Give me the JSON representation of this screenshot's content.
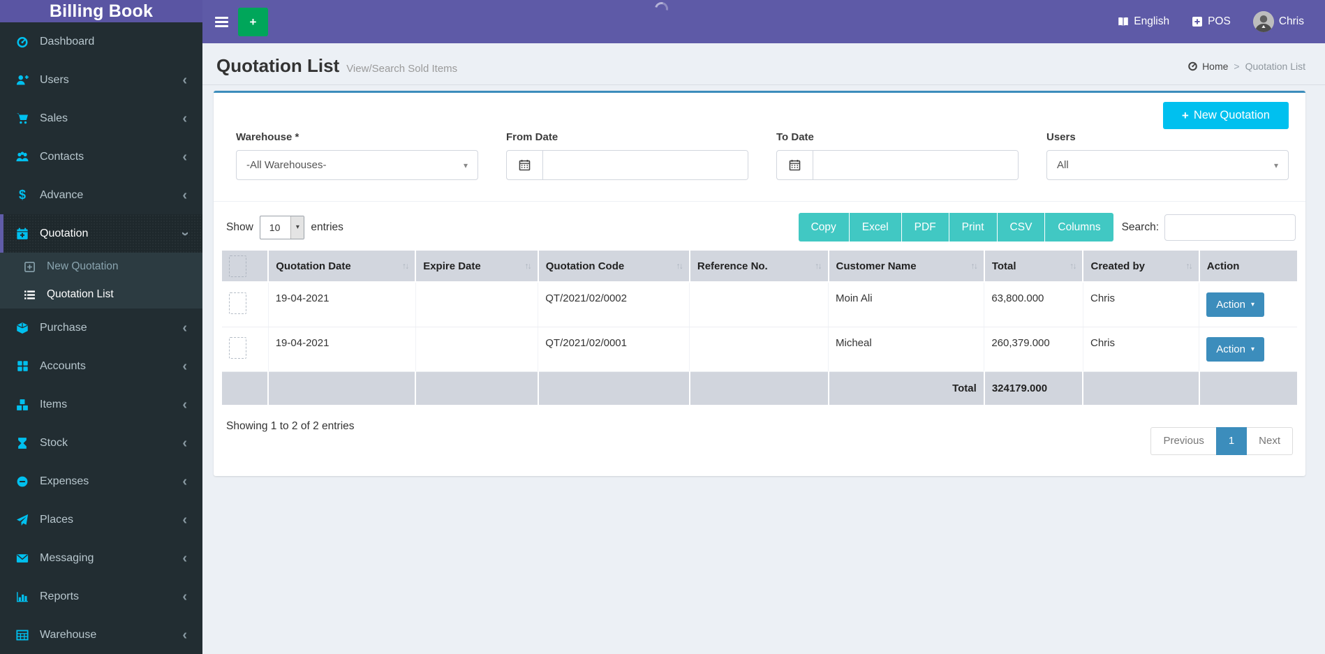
{
  "app": {
    "title": "Billing Book"
  },
  "topbar": {
    "language_label": "English",
    "pos_label": "POS",
    "user_name": "Chris"
  },
  "sidebar": {
    "items": [
      {
        "label": "Dashboard",
        "icon": "gauge-icon"
      },
      {
        "label": "Users",
        "icon": "user-plus-icon"
      },
      {
        "label": "Sales",
        "icon": "cart-icon"
      },
      {
        "label": "Contacts",
        "icon": "users-icon"
      },
      {
        "label": "Advance",
        "icon": "dollar-icon"
      },
      {
        "label": "Quotation",
        "icon": "calendar-plus-icon",
        "active": true,
        "expanded": true,
        "children": [
          {
            "label": "New Quotation",
            "icon": "plus-square-icon",
            "active": false
          },
          {
            "label": "Quotation List",
            "icon": "list-icon",
            "active": true
          }
        ]
      },
      {
        "label": "Purchase",
        "icon": "cube-icon"
      },
      {
        "label": "Accounts",
        "icon": "grid-icon"
      },
      {
        "label": "Items",
        "icon": "cubes-icon"
      },
      {
        "label": "Stock",
        "icon": "hourglass-icon"
      },
      {
        "label": "Expenses",
        "icon": "minus-circle-icon"
      },
      {
        "label": "Places",
        "icon": "send-icon"
      },
      {
        "label": "Messaging",
        "icon": "envelope-icon"
      },
      {
        "label": "Reports",
        "icon": "bar-chart-icon"
      },
      {
        "label": "Warehouse",
        "icon": "table-icon"
      }
    ]
  },
  "page": {
    "title": "Quotation List",
    "subtitle": "View/Search Sold Items",
    "breadcrumb": {
      "home": "Home",
      "separator": ">",
      "current": "Quotation List"
    }
  },
  "filters": {
    "new_quotation_button": "New Quotation",
    "warehouse": {
      "label": "Warehouse *",
      "selected": "-All Warehouses-"
    },
    "from_date": {
      "label": "From Date",
      "value": ""
    },
    "to_date": {
      "label": "To Date",
      "value": ""
    },
    "users": {
      "label": "Users",
      "selected": "All"
    }
  },
  "table_controls": {
    "show_label": "Show",
    "page_length": "10",
    "entries_label": "entries",
    "export_buttons": [
      "Copy",
      "Excel",
      "PDF",
      "Print",
      "CSV",
      "Columns"
    ],
    "search_label": "Search:",
    "search_value": ""
  },
  "table": {
    "columns": [
      "Quotation Date",
      "Expire Date",
      "Quotation Code",
      "Reference No.",
      "Customer Name",
      "Total",
      "Created by",
      "Action"
    ],
    "rows": [
      {
        "quotation_date": "19-04-2021",
        "expire_date": "",
        "quotation_code": "QT/2021/02/0002",
        "reference_no": "",
        "customer_name": "Moin Ali",
        "total": "63,800.000",
        "created_by": "Chris",
        "action_label": "Action"
      },
      {
        "quotation_date": "19-04-2021",
        "expire_date": "",
        "quotation_code": "QT/2021/02/0001",
        "reference_no": "",
        "customer_name": "Micheal",
        "total": "260,379.000",
        "created_by": "Chris",
        "action_label": "Action"
      }
    ],
    "footer": {
      "total_label": "Total",
      "total_value": "324179.000"
    }
  },
  "list_footer": {
    "showing_text": "Showing 1 to 2 of 2 entries",
    "pagination": {
      "previous": "Previous",
      "current_page": "1",
      "next": "Next"
    }
  },
  "colors": {
    "topbar_purple": "#5e5aa7",
    "logo_purple": "#5a55a3",
    "sidebar_dark": "#222d32",
    "icon_cyan": "#00c0ef",
    "green_add_button": "#00a65a",
    "new_quotation_button": "#00c0ef",
    "export_button_teal": "#41c8c3",
    "primary_blue": "#3c8dbc",
    "table_header_gray": "#d2d6de",
    "content_bg": "#ecf0f5"
  }
}
